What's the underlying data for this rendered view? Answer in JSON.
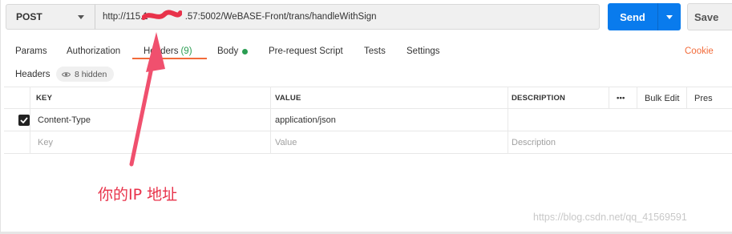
{
  "request": {
    "method": "POST",
    "url": "http://115.1    .57:5002/WeBASE-Front/trans/handleWithSign",
    "send_label": "Send",
    "save_label": "Save"
  },
  "tabs": [
    {
      "label": "Params"
    },
    {
      "label": "Authorization"
    },
    {
      "label": "Headers",
      "count": "(9)",
      "active": true
    },
    {
      "label": "Body"
    },
    {
      "label": "Pre-request Script"
    },
    {
      "label": "Tests"
    },
    {
      "label": "Settings"
    }
  ],
  "cookies_label": "Cookie",
  "headers_section": {
    "title": "Headers",
    "hidden_label": "8 hidden"
  },
  "table": {
    "columns": {
      "key": "KEY",
      "value": "VALUE",
      "description": "DESCRIPTION",
      "more": "•••",
      "bulk_edit": "Bulk Edit",
      "presets": "Pres"
    },
    "rows": [
      {
        "checked": true,
        "key": "Content-Type",
        "value": "application/json",
        "description": ""
      }
    ],
    "new_row": {
      "key_placeholder": "Key",
      "value_placeholder": "Value",
      "description_placeholder": "Description"
    }
  },
  "annotation": {
    "text": "你的IP 地址",
    "color": "#e8324a"
  },
  "watermark": "https://blog.csdn.net/qq_41569591",
  "colors": {
    "accent": "#f26b3a",
    "send": "#097bed",
    "status_green": "#2a9d52",
    "arrow": "#f0506e"
  }
}
